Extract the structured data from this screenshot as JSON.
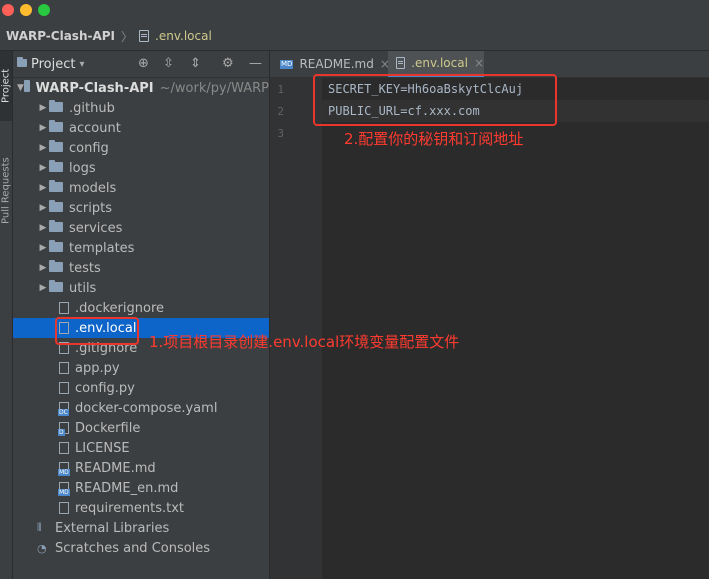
{
  "window": {
    "traffic_lights": [
      "close",
      "minimize",
      "zoom"
    ]
  },
  "navbar": {
    "project": "WARP-Clash-API",
    "separator": "〉",
    "file": ".env.local"
  },
  "left_strip": {
    "project_tab": "Project",
    "pull_requests_tab": "Pull Requests"
  },
  "sidebar": {
    "title": "Project",
    "title_suffix": "▾",
    "toolbar_icons": [
      "target-icon",
      "expand-all-icon",
      "collapse-all-icon",
      "gear-icon",
      "hide-icon"
    ],
    "root": {
      "label": "WARP-Clash-API",
      "hint": "~/work/py/WARP"
    },
    "folders": [
      "github",
      "account",
      "config",
      "logs",
      "models",
      "scripts",
      "services",
      "templates",
      "tests",
      "utils"
    ],
    "folder_labels": [
      ".github",
      "account",
      "config",
      "logs",
      "models",
      "scripts",
      "services",
      "templates",
      "tests",
      "utils"
    ],
    "files": [
      {
        "label": ".dockerignore",
        "tag": ""
      },
      {
        "label": ".env.local",
        "tag": "",
        "selected": true
      },
      {
        "label": ".gitignore",
        "tag": ""
      },
      {
        "label": "app.py",
        "tag": ""
      },
      {
        "label": "config.py",
        "tag": ""
      },
      {
        "label": "docker-compose.yaml",
        "tag": "DC"
      },
      {
        "label": "Dockerfile",
        "tag": "D"
      },
      {
        "label": "LICENSE",
        "tag": ""
      },
      {
        "label": "README.md",
        "tag": "MD"
      },
      {
        "label": "README_en.md",
        "tag": "MD"
      },
      {
        "label": "requirements.txt",
        "tag": ""
      }
    ],
    "external_libraries": "External Libraries",
    "scratches": "Scratches and Consoles"
  },
  "tabs": [
    {
      "label": "README.md",
      "icon_tag": "MD",
      "active": false
    },
    {
      "label": ".env.local",
      "icon_tag": "",
      "active": true
    }
  ],
  "editor": {
    "lines": [
      "SECRET_KEY=Hh6oaBskytClcAuj",
      "PUBLIC_URL=cf.xxx.com"
    ],
    "line_numbers": [
      "1",
      "2",
      "3"
    ]
  },
  "annotations": {
    "step1": "1.项目根目录创建.env.local环境变量配置文件",
    "step2": "2.配置你的秘钥和订阅地址"
  },
  "colors": {
    "accent": "#0d64c9",
    "annotation_red": "#e8362d",
    "selected_file_text": "#cfc98d"
  }
}
